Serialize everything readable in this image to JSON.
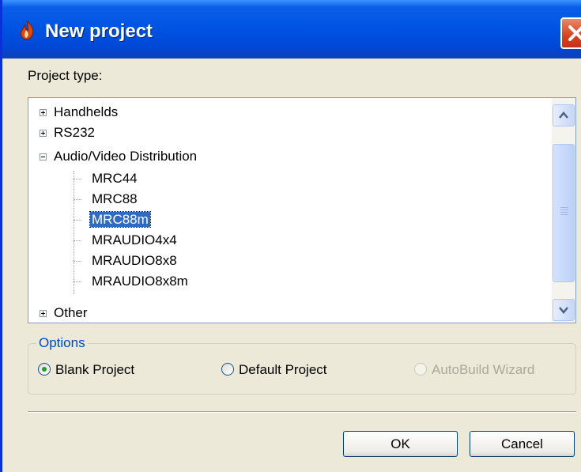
{
  "window": {
    "title": "New project"
  },
  "project_type_label": "Project type:",
  "tree": {
    "nodes": [
      {
        "label": "Handhelds",
        "state": "collapsed"
      },
      {
        "label": "RS232",
        "state": "collapsed"
      },
      {
        "label": "Audio/Video Distribution",
        "state": "expanded"
      },
      {
        "label": "MRC44"
      },
      {
        "label": "MRC88"
      },
      {
        "label": "MRC88m",
        "selected": true
      },
      {
        "label": "MRAUDIO4x4"
      },
      {
        "label": "MRAUDIO8x8"
      },
      {
        "label": "MRAUDIO8x8m"
      },
      {
        "label": "Other",
        "state": "collapsed"
      }
    ]
  },
  "options": {
    "title": "Options",
    "radios": [
      {
        "label": "Blank Project",
        "checked": true,
        "enabled": true
      },
      {
        "label": "Default Project",
        "checked": false,
        "enabled": true
      },
      {
        "label": "AutoBuild Wizard",
        "checked": false,
        "enabled": false
      }
    ]
  },
  "buttons": {
    "ok": "OK",
    "cancel": "Cancel"
  },
  "colors": {
    "titlebar": "#0054e3",
    "selection": "#316ac5",
    "group_title": "#0046d5",
    "close_button": "#d6421d"
  }
}
